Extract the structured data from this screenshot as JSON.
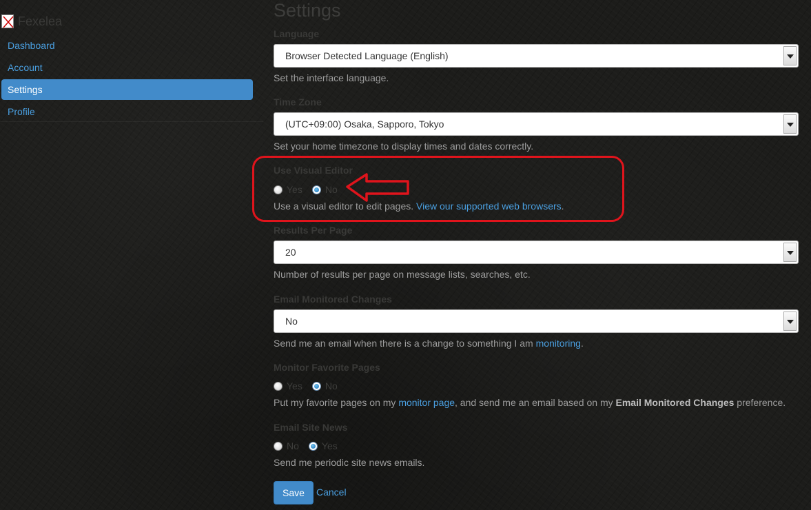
{
  "brand": {
    "name": "Fexelea",
    "logo_icon": "broken-image-icon"
  },
  "sidebar": {
    "items": [
      {
        "label": "Dashboard",
        "active": false
      },
      {
        "label": "Account",
        "active": false
      },
      {
        "label": "Settings",
        "active": true
      },
      {
        "label": "Profile",
        "active": false
      }
    ]
  },
  "main": {
    "title": "Settings",
    "language": {
      "label": "Language",
      "value": "Browser Detected Language (English)",
      "help": "Set the interface language."
    },
    "timezone": {
      "label": "Time Zone",
      "value": "(UTC+09:00) Osaka, Sapporo, Tokyo",
      "help": "Set your home timezone to display times and dates correctly."
    },
    "visual_editor": {
      "label": "Use Visual Editor",
      "options": [
        "Yes",
        "No"
      ],
      "selected": "No",
      "help_text": "Use a visual editor to edit pages. ",
      "help_link": "View our supported web browsers",
      "help_end": "."
    },
    "results_per_page": {
      "label": "Results Per Page",
      "value": "20",
      "help": "Number of results per page on message lists, searches, etc."
    },
    "email_monitored": {
      "label": "Email Monitored Changes",
      "value": "No",
      "help_text": "Send me an email when there is a change to something I am ",
      "help_link": "monitoring",
      "help_end": "."
    },
    "monitor_favorite": {
      "label": "Monitor Favorite Pages",
      "options": [
        "Yes",
        "No"
      ],
      "selected": "No",
      "help_text": "Put my favorite pages on my ",
      "help_link": "monitor page",
      "help_mid": ", and send me an email based on my ",
      "help_bold": "Email Monitored Changes",
      "help_end": " preference."
    },
    "email_news": {
      "label": "Email Site News",
      "options": [
        "No",
        "Yes"
      ],
      "selected": "Yes",
      "help": "Send me periodic site news emails."
    },
    "actions": {
      "save_label": "Save",
      "cancel_label": "Cancel"
    }
  },
  "colors": {
    "accent": "#428bca",
    "link": "#4a9fe0",
    "annotation": "#e0141c"
  }
}
